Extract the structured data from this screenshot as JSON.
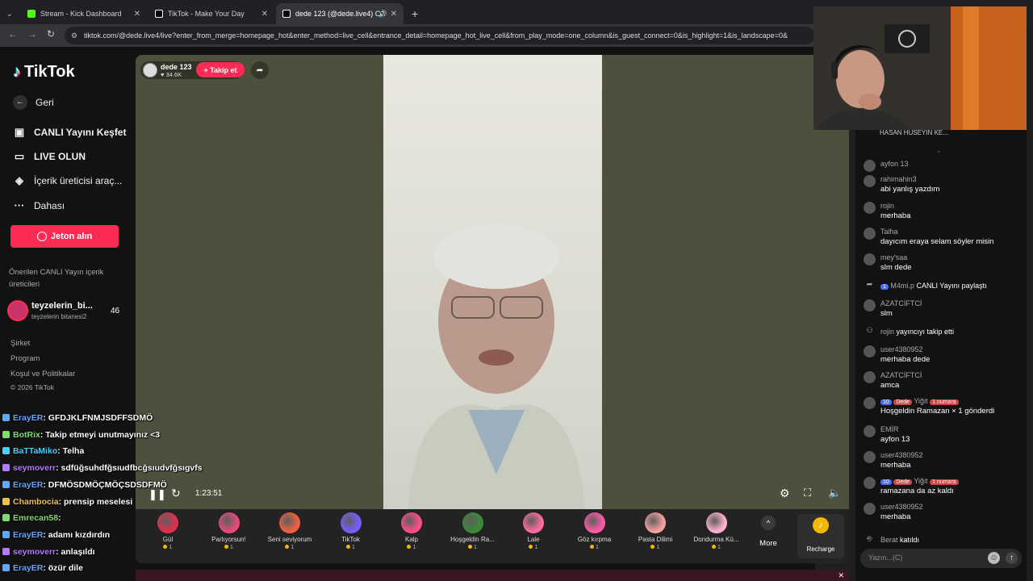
{
  "browser": {
    "tabs": [
      {
        "title": "Stream - Kick Dashboard",
        "color": "#53fc18"
      },
      {
        "title": "TikTok - Make Your Day",
        "color": "#000000"
      },
      {
        "title": "dede 123 (@dede.live4) CA",
        "color": "#000000"
      }
    ],
    "new_tab": "+",
    "url": "tiktok.com/@dede.live4/live?enter_from_merge=homepage_hot&enter_method=live_cell&entrance_detail=homepage_hot_live_cell&from_play_mode=one_column&is_guest_connect=0&is_highlight=1&is_landscape=0&"
  },
  "sidebar": {
    "logo": "TikTok",
    "items": [
      {
        "icon": "back-arrow-icon",
        "label": "Geri"
      },
      {
        "icon": "live-explore-icon",
        "label": "CANLI Yayını Keşfet"
      },
      {
        "icon": "go-live-icon",
        "label": "LIVE OLUN"
      },
      {
        "icon": "creator-tools-icon",
        "label": "İçerik üreticisi araç..."
      },
      {
        "icon": "more-icon",
        "label": "Dahası"
      }
    ],
    "coin_button": "Jeton alın",
    "suggested_title": "Önerilen CANLI Yayın içerik üreticileri",
    "suggested": {
      "name": "teyzelerin_bi...",
      "sub": "teyzelerin bitanesi2",
      "count": "46"
    },
    "footer": [
      "Şirket",
      "Program",
      "Koşul ve Politikalar",
      "© 2026 TikTok"
    ]
  },
  "stream": {
    "host_name": "dede 123",
    "host_likes": "34.6K",
    "follow_label": "+ Takip et",
    "time": "1:23:51"
  },
  "gifts": [
    {
      "name": "Gül",
      "cost": "1",
      "color": "#e0304a"
    },
    {
      "name": "Parlıyorsun!",
      "cost": "1",
      "color": "#e84a7a"
    },
    {
      "name": "Seni seviyorum",
      "cost": "1",
      "color": "#f06040"
    },
    {
      "name": "TikTok",
      "cost": "1",
      "color": "#7a5cff"
    },
    {
      "name": "Kalp",
      "cost": "1",
      "color": "#ff4d8a"
    },
    {
      "name": "Hoşgeldin Ra...",
      "cost": "1",
      "color": "#3a8a3a"
    },
    {
      "name": "Lale",
      "cost": "1",
      "color": "#ff6aa0"
    },
    {
      "name": "Göz kırpma",
      "cost": "1",
      "color": "#ff5aa8"
    },
    {
      "name": "Pasta Dilimi",
      "cost": "1",
      "color": "#f4a0a0"
    },
    {
      "name": "Dondurma Kü...",
      "cost": "1",
      "color": "#ffb0d0"
    }
  ],
  "gift_more": "More",
  "recharge": "Recharge",
  "overlay_chat": [
    {
      "user": "ErayER",
      "text": ": GFDJKLFNMJSDFFSDMÖ",
      "color": "#5fa8ff"
    },
    {
      "user": "BotRix",
      "text": ": Takip etmeyi unutmayınız <3",
      "color": "#7cdf6a"
    },
    {
      "user": "BaTTaMiko",
      "text": ": Telha",
      "color": "#4ad0ff"
    },
    {
      "user": "seymoverr",
      "text": ": sdfüğsuhdfğsıudfbcğsıudvfğsıgvfs",
      "color": "#b67aff"
    },
    {
      "user": "ErayER",
      "text": ": DFMÖSDMÖÇMÖÇSDSDFMÖ",
      "color": "#5fa8ff"
    },
    {
      "user": "Chambocia",
      "text": ": prensip meselesi",
      "color": "#f0c048"
    },
    {
      "user": "Emrecan58",
      "text": ":",
      "color": "#7cdf6a"
    },
    {
      "user": "ErayER",
      "text": ": adamı kızdırdın",
      "color": "#5fa8ff"
    },
    {
      "user": "seymoverr",
      "text": ": anlaşıldı",
      "color": "#b67aff"
    },
    {
      "user": "ErayER",
      "text": ": özür dile",
      "color": "#5fa8ff"
    }
  ],
  "chat": {
    "top_banner": "HASAN HÜSEYİN KE...",
    "messages": [
      {
        "user": "ayfon 13",
        "text": ""
      },
      {
        "user": "rahimahin3",
        "text": "abi yanlış yazdım"
      },
      {
        "user": "rojin",
        "text": "merhaba"
      },
      {
        "user": "Talha",
        "text": "dayıcım eraya selam söyler misin"
      },
      {
        "user": "mey'saa",
        "text": "slm dede"
      },
      {
        "user": "M4mi.p",
        "text": "CANLI Yayını paylaştı",
        "level": "1"
      },
      {
        "user": "AZATCİFTCİ",
        "text": "slm"
      },
      {
        "user": "rojin",
        "text": "yayıncıyı takip etti"
      },
      {
        "user": "user4380952",
        "text": "merhaba dede"
      },
      {
        "user": "AZATCİFTCİ",
        "text": "amca"
      },
      {
        "user": "Yiğit",
        "text": "Hoşgeldin Ramazan × 1 gönderdi",
        "level": "10",
        "fan": "Dede",
        "rank": "1 numara"
      },
      {
        "user": "EMİR",
        "text": "ayfon 13"
      },
      {
        "user": "user4380952",
        "text": "merhaba"
      },
      {
        "user": "Yiğit",
        "text": "ramazana da az kaldı",
        "level": "10",
        "fan": "Dede",
        "rank": "1 numara"
      },
      {
        "user": "user4380952",
        "text": "merhaba"
      },
      {
        "user": "Berat",
        "text": "katıldı"
      }
    ],
    "input_placeholder": "Yazın...(C)"
  }
}
